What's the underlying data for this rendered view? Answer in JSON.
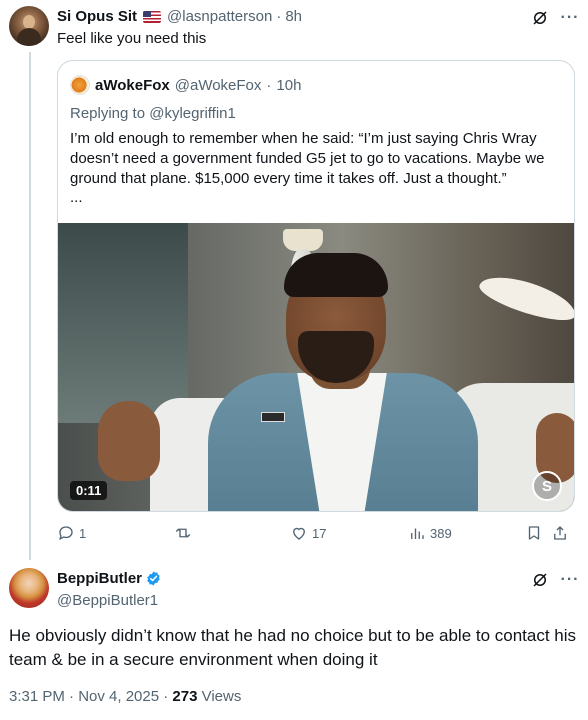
{
  "post": {
    "author_name": "Si Opus Sit",
    "handle": "@lasnpatterson",
    "time": "8h",
    "text": "Feel like you need this",
    "icons": {
      "grok": "grok-icon",
      "more": "more-icon",
      "flag": "us-flag-icon"
    }
  },
  "quote": {
    "author_name": "aWokeFox",
    "handle": "@aWokeFox",
    "time": "10h",
    "replying_to_prefix": "Replying to",
    "replying_to": "@kylegriffin1",
    "text": "I’m old enough to remember when he said: “I’m just saying Chris Wray doesn’t need a government funded G5 jet to go to vacations. Maybe we ground that plane. $15,000 every time it takes off. Just a thought.”",
    "ellipsis": "...",
    "video": {
      "duration": "0:11",
      "watermark": "S"
    }
  },
  "actions": {
    "reply_count": "1",
    "repost_count": "",
    "like_count": "17",
    "views_count": "389"
  },
  "reply": {
    "author_name": "BeppiButler",
    "handle": "@BeppiButler1",
    "verified": true,
    "text": "He obviously didn’t know that he had no choice but to be able to contact his team & be in a secure environment when doing it",
    "timestamp": "3:31 PM · Nov 4, 2025 · ",
    "views_count": "273",
    "views_label": " Views",
    "colors": {
      "verified": "#1d9bf0",
      "muted": "#536471"
    }
  }
}
